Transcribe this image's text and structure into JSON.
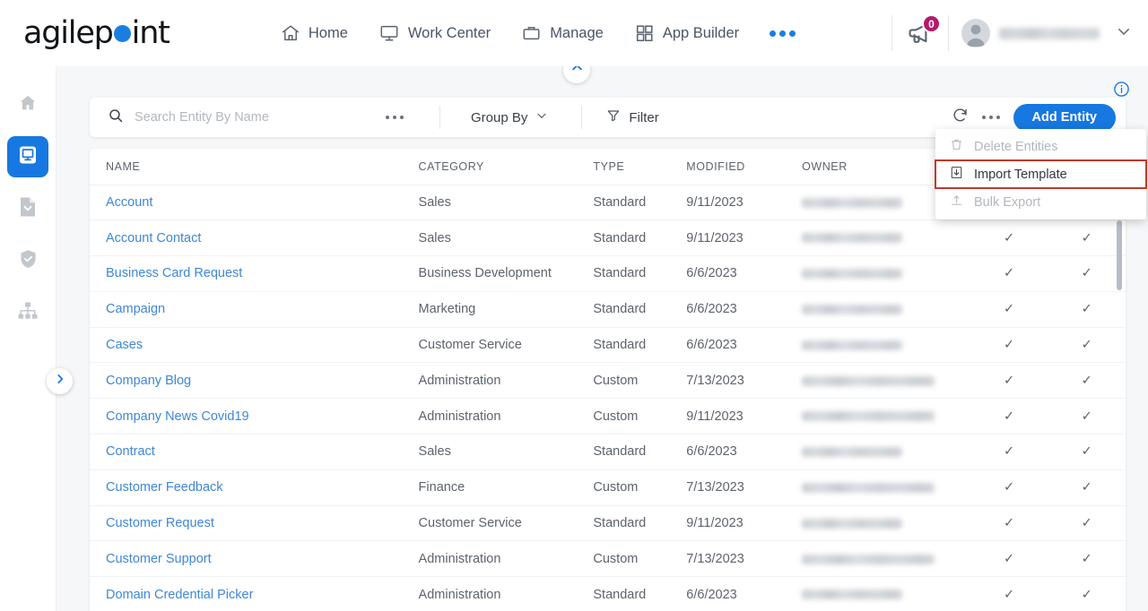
{
  "brand": {
    "name_a": "agilep",
    "name_b": "int",
    "accent": "#1a7ee0"
  },
  "topnav": {
    "items": [
      {
        "label": "Home",
        "icon": "home-icon"
      },
      {
        "label": "Work Center",
        "icon": "monitor-icon"
      },
      {
        "label": "Manage",
        "icon": "briefcase-icon"
      },
      {
        "label": "App Builder",
        "icon": "grid-icon"
      }
    ],
    "more_label": "•••",
    "notification_count": "0",
    "notification_color": "#b4196b",
    "user_name": ""
  },
  "rail": {
    "items": [
      {
        "name": "home-icon",
        "active": false
      },
      {
        "name": "monitor-icon",
        "active": true
      },
      {
        "name": "document-icon",
        "active": false
      },
      {
        "name": "shield-check-icon",
        "active": false
      },
      {
        "name": "org-chart-icon",
        "active": false
      }
    ]
  },
  "toolbar": {
    "search_placeholder": "Search Entity By Name",
    "search_value": "",
    "group_by_label": "Group By",
    "filter_label": "Filter",
    "add_entity_label": "Add Entity"
  },
  "menu": {
    "items": [
      {
        "label": "Delete Entities",
        "icon": "trash-icon",
        "enabled": false,
        "highlighted": false
      },
      {
        "label": "Import Template",
        "icon": "import-icon",
        "enabled": true,
        "highlighted": true
      },
      {
        "label": "Bulk Export",
        "icon": "export-icon",
        "enabled": false,
        "highlighted": false
      }
    ],
    "highlight_color": "#c0392b"
  },
  "table": {
    "columns": [
      "NAME",
      "CATEGORY",
      "TYPE",
      "MODIFIED",
      "OWNER",
      "",
      ""
    ],
    "rows": [
      {
        "name": "Account",
        "category": "Sales",
        "type": "Standard",
        "modified": "9/11/2023",
        "owner": "",
        "owner_width": 112,
        "check1": "✓",
        "check2": "✓"
      },
      {
        "name": "Account Contact",
        "category": "Sales",
        "type": "Standard",
        "modified": "9/11/2023",
        "owner": "",
        "owner_width": 112,
        "check1": "✓",
        "check2": "✓"
      },
      {
        "name": "Business Card Request",
        "category": "Business Development",
        "type": "Standard",
        "modified": "6/6/2023",
        "owner": "",
        "owner_width": 112,
        "check1": "✓",
        "check2": "✓"
      },
      {
        "name": "Campaign",
        "category": "Marketing",
        "type": "Standard",
        "modified": "6/6/2023",
        "owner": "",
        "owner_width": 112,
        "check1": "✓",
        "check2": "✓"
      },
      {
        "name": "Cases",
        "category": "Customer Service",
        "type": "Standard",
        "modified": "6/6/2023",
        "owner": "",
        "owner_width": 112,
        "check1": "✓",
        "check2": "✓"
      },
      {
        "name": "Company Blog",
        "category": "Administration",
        "type": "Custom",
        "modified": "7/13/2023",
        "owner": "",
        "owner_width": 148,
        "check1": "✓",
        "check2": "✓"
      },
      {
        "name": "Company News Covid19",
        "category": "Administration",
        "type": "Custom",
        "modified": "9/11/2023",
        "owner": "",
        "owner_width": 148,
        "check1": "✓",
        "check2": "✓"
      },
      {
        "name": "Contract",
        "category": "Sales",
        "type": "Standard",
        "modified": "6/6/2023",
        "owner": "",
        "owner_width": 112,
        "check1": "✓",
        "check2": "✓"
      },
      {
        "name": "Customer Feedback",
        "category": "Finance",
        "type": "Custom",
        "modified": "7/13/2023",
        "owner": "",
        "owner_width": 148,
        "check1": "✓",
        "check2": "✓"
      },
      {
        "name": "Customer Request",
        "category": "Customer Service",
        "type": "Standard",
        "modified": "9/11/2023",
        "owner": "",
        "owner_width": 112,
        "check1": "✓",
        "check2": "✓"
      },
      {
        "name": "Customer Support",
        "category": "Administration",
        "type": "Custom",
        "modified": "7/13/2023",
        "owner": "",
        "owner_width": 148,
        "check1": "✓",
        "check2": "✓"
      },
      {
        "name": "Domain Credential Picker",
        "category": "Administration",
        "type": "Standard",
        "modified": "6/6/2023",
        "owner": "",
        "owner_width": 112,
        "check1": "✓",
        "check2": "✓"
      }
    ]
  }
}
